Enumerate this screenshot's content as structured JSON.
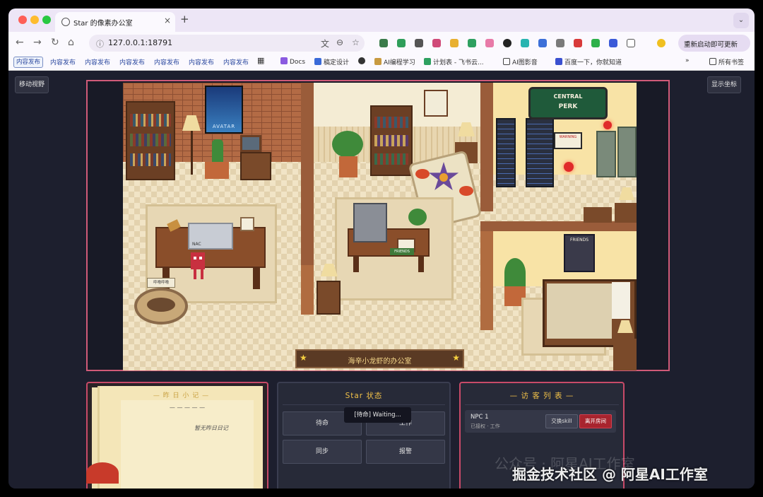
{
  "browser": {
    "tab_title": "Star 的像素办公室",
    "url": "127.0.0.1:18791",
    "update_button": "重新启动即可更新",
    "bookmarks": [
      {
        "label": "内容发布",
        "chip": true
      },
      {
        "label": "内容发布",
        "chip": false
      },
      {
        "label": "内容发布",
        "chip": false
      },
      {
        "label": "内容发布",
        "chip": false
      },
      {
        "label": "内容发布",
        "chip": false
      },
      {
        "label": "内容发布",
        "chip": false
      },
      {
        "label": "内容发布",
        "chip": false
      }
    ],
    "bookmarks_named": {
      "docs": "Docs",
      "design": "稿定设计",
      "ai_learn": "AI编程学习",
      "plan": "计划表 - 飞书云...",
      "ai_image": "AI图影音",
      "baidu": "百度一下，你就知道",
      "all": "所有书签"
    },
    "tabmenu_glyph": "⌄",
    "close_glyph": "×",
    "new_tab_glyph": "+"
  },
  "app": {
    "move_view_button": "移动视野",
    "show_coords_button": "显示坐标",
    "scene": {
      "avatar_poster": "AVATAR",
      "cafe_sign_line1": "CENTRAL",
      "cafe_sign_line2": "PERK",
      "friends_poster": "FRIENDS",
      "nameplate": "海辛小龙虾的办公室",
      "pet_bubble": "呼噜呼噜",
      "monitor_label": "NAC",
      "warning_sign": "WARNING",
      "mug_label": "FRIENDS"
    },
    "diary": {
      "title": "— 昨 日 小 记 —",
      "dashes": "— — — — —",
      "empty_text": "暂无昨日日记"
    },
    "status_panel": {
      "title": "Star 状态",
      "buttons": [
        "待命",
        "工作",
        "同步",
        "报警"
      ]
    },
    "visitors": {
      "title": "— 访 客 列 表 —",
      "npc_name": "NPC 1",
      "npc_status": "已接权 · 工作",
      "swap_button": "交换skill",
      "leave_button": "离开房间"
    },
    "toast": "[待命] Waiting..."
  },
  "watermark": {
    "line1": "公众号 · 阿星AI工作室",
    "line2": "掘金技术社区 @ 阿星AI工作室"
  },
  "colors": {
    "panel_border": "#c84a68",
    "title_gold": "#f0c048",
    "leave_button": "#a8242e"
  }
}
